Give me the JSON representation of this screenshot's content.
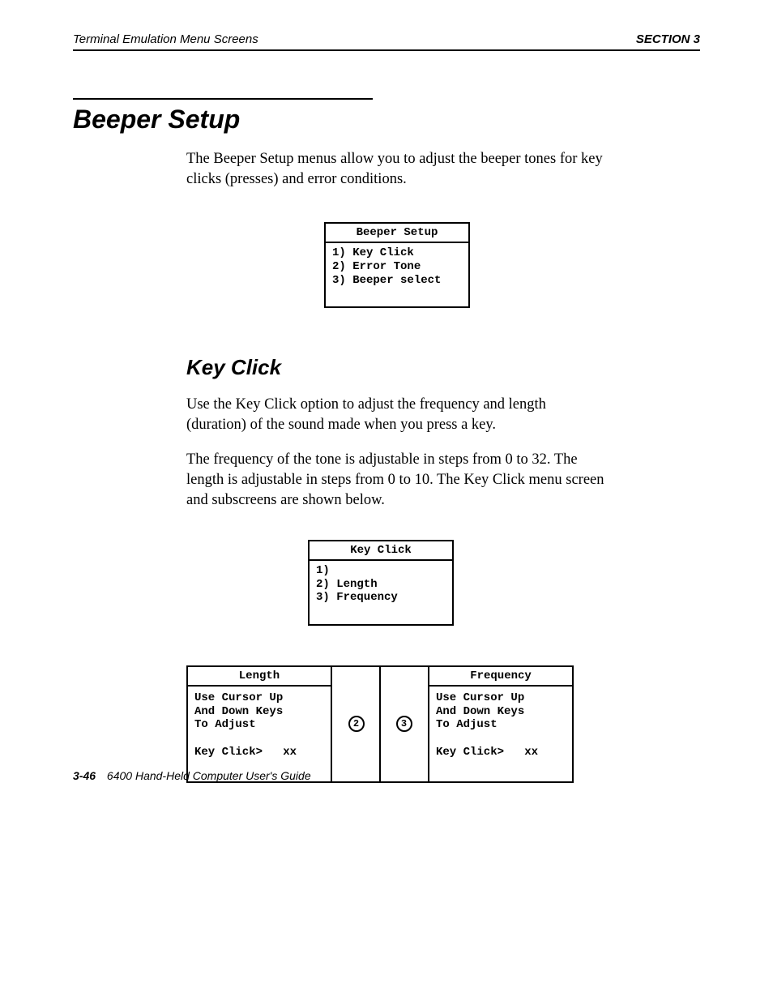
{
  "header": {
    "left": "Terminal Emulation Menu Screens",
    "right": "SECTION 3"
  },
  "h1": "Beeper Setup",
  "intro": "The Beeper Setup menus allow you to adjust the beeper tones for key clicks (presses) and error conditions.",
  "beeper_box": {
    "title": "Beeper Setup",
    "items": [
      "1) Key Click",
      "2) Error Tone",
      "3) Beeper select"
    ]
  },
  "h2": "Key Click",
  "kc_p1": "Use the Key Click option to adjust the frequency and length (duration) of the sound made when you press a key.",
  "kc_p2": "The frequency of the tone is adjustable in steps from 0 to 32. The length is adjustable in steps from 0 to 10. The Key Click menu screen and subscreens are shown below.",
  "kc_box": {
    "title": "Key Click",
    "items": [
      "1)",
      "2) Length",
      "3) Frequency"
    ]
  },
  "len_box": {
    "title": "Length",
    "lines": [
      "Use Cursor Up",
      "And Down Keys",
      "To Adjust",
      "",
      "Key Click>   xx"
    ]
  },
  "freq_box": {
    "title": "Frequency",
    "lines": [
      "Use Cursor Up",
      "And Down Keys",
      "To Adjust",
      "",
      "Key Click>   xx"
    ]
  },
  "connector": {
    "left_num": "2",
    "right_num": "3"
  },
  "footer": {
    "page": "3-46",
    "title": "6400 Hand-Held Computer User's Guide"
  }
}
